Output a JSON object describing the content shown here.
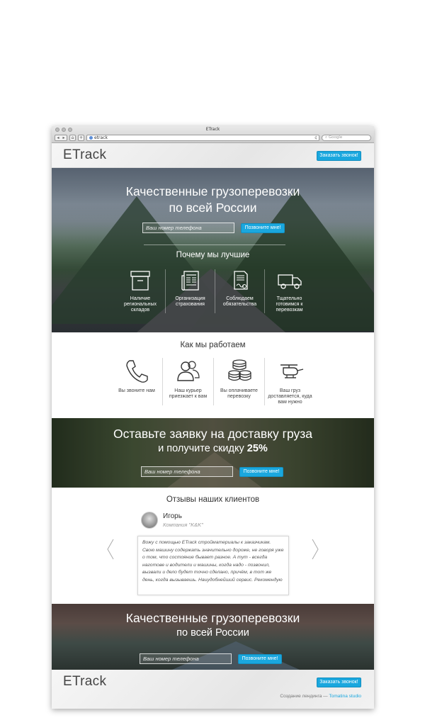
{
  "browser": {
    "window_title": "ETrack",
    "url": "etrack",
    "search_placeholder": "Google",
    "back": "◂",
    "forward": "▸",
    "home": "⌂",
    "add": "+",
    "reload": "¢"
  },
  "header": {
    "logo": "ETrack",
    "callback_button": "Заказать звонок!"
  },
  "hero": {
    "title_line1": "Качественные грузоперевозки",
    "title_line2": "по всей России",
    "phone_placeholder": "Ваш номер телефона",
    "call_button": "Позвоните мне!",
    "why_title": "Почему мы лучшие",
    "features": [
      {
        "icon": "box-icon",
        "label": "Наличие региональных складов"
      },
      {
        "icon": "newspaper-icon",
        "label": "Организация страхования"
      },
      {
        "icon": "contract-icon",
        "label": "Соблюдаем обязательства"
      },
      {
        "icon": "truck-icon",
        "label": "Тщательно готовимся к перевозкам"
      }
    ]
  },
  "how": {
    "title": "Как мы работаем",
    "steps": [
      {
        "icon": "phone-icon",
        "label": "Вы звоните нам"
      },
      {
        "icon": "users-icon",
        "label": "Наш курьер приезжает к вам"
      },
      {
        "icon": "coins-icon",
        "label": "Вы оплачиваете перевозку"
      },
      {
        "icon": "helicopter-icon",
        "label": "Ваш груз доставляется, куда вам нужно"
      }
    ]
  },
  "promo": {
    "title_line1": "Оставьте заявку на доставку груза",
    "title_line2_prefix": "и получите скидку ",
    "discount": "25%",
    "phone_placeholder": "Ваш номер телефона",
    "call_button": "Позвоните мне!"
  },
  "reviews": {
    "title": "Отзывы наших клиентов",
    "name": "Игорь",
    "company": "Компания \"K&K\"",
    "text": "Вожу с помощью ETrack стройматериалы к заказчикам. Свою машину содержать значительно дороже, не говоря уже о том, что состояние бывает разное. А тут - всегда наготове и водители и машины, когда надо - позвонил, вызвали и дело будет точно сделано, причём, в тот же день, когда вызываешь. Наиудобнейший сервис. Рекомендую"
  },
  "bottom_hero": {
    "title_line1": "Качественные грузоперевозки",
    "title_line2": "по всей России",
    "phone_placeholder": "Ваш номер телефона",
    "call_button": "Позвоните мне!"
  },
  "footer": {
    "logo": "ETrack",
    "callback_button": "Заказать звонок!",
    "credits_prefix": "Создание лендинга — ",
    "credits_studio": "Tomatina studio"
  },
  "colors": {
    "accent": "#1aa7de",
    "text": "#333333"
  }
}
